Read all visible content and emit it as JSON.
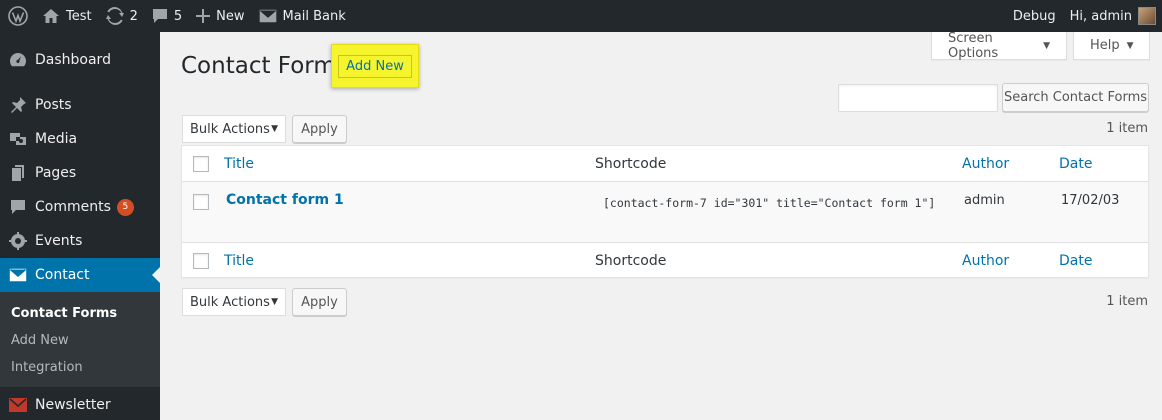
{
  "adminbar": {
    "site_name": "Test",
    "updates_count": "2",
    "comments_count": "5",
    "new_label": "New",
    "plugin_label": "Mail Bank",
    "debug_label": "Debug",
    "greeting": "Hi, admin"
  },
  "sidebar": {
    "items": [
      {
        "label": "Dashboard",
        "icon": "dashboard-icon"
      },
      {
        "label": "Posts",
        "icon": "pin-icon"
      },
      {
        "label": "Media",
        "icon": "media-icon"
      },
      {
        "label": "Pages",
        "icon": "pages-icon"
      },
      {
        "label": "Comments",
        "icon": "comment-icon",
        "badge": "5"
      },
      {
        "label": "Events",
        "icon": "events-icon"
      },
      {
        "label": "Contact",
        "icon": "mail-icon",
        "current": true
      },
      {
        "label": "Newsletter",
        "icon": "newsletter-icon"
      }
    ],
    "submenu": [
      "Contact Forms",
      "Add New",
      "Integration"
    ]
  },
  "header": {
    "screen_options": "Screen Options",
    "help": "Help",
    "title": "Contact Forms",
    "add_new": "Add New",
    "search_button": "Search Contact Forms",
    "search_value": ""
  },
  "bulk": {
    "selected": "Bulk Actions",
    "apply": "Apply",
    "count": "1 item"
  },
  "table": {
    "columns": [
      "Title",
      "Shortcode",
      "Author",
      "Date"
    ],
    "rows": [
      {
        "title": "Contact form 1",
        "shortcode": "[contact-form-7 id=\"301\" title=\"Contact form 1\"]",
        "author": "admin",
        "date": "17/02/03"
      }
    ]
  },
  "colors": {
    "accent": "#0073aa",
    "highlight": "#f6f42d",
    "sidebar": "#23282d",
    "badge": "#d54e21"
  }
}
